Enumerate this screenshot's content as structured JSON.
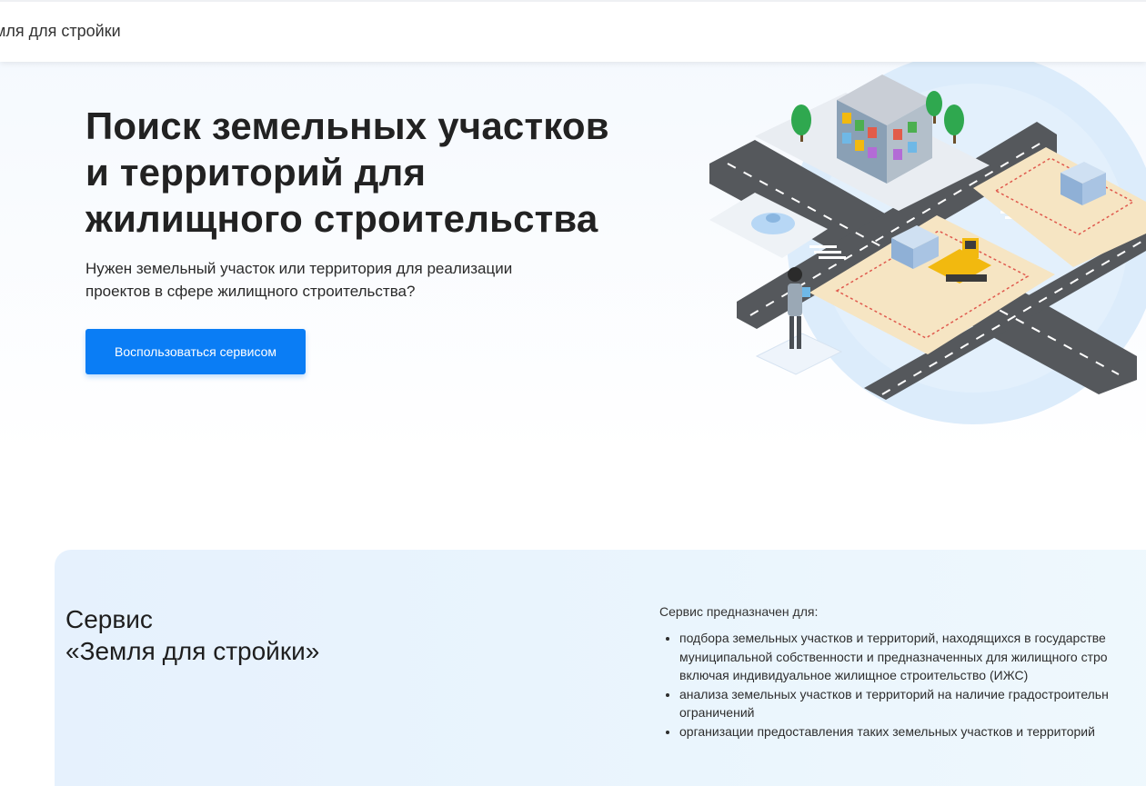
{
  "header": {
    "brand_text": "мля для стройки"
  },
  "hero": {
    "title_line1": "Поиск земельных участков",
    "title_line2": "и территорий для",
    "title_line3": "жилищного строительства",
    "subtitle_line1": "Нужен земельный участок или территория для реализации",
    "subtitle_line2": "проектов в сфере жилищного строительства?",
    "cta_label": "Воспользоваться сервисом"
  },
  "info": {
    "title_line1": "Сервис",
    "title_line2": "«Земля для стройки»",
    "purpose_intro": "Сервис предназначен для:",
    "purpose_items": [
      {
        "line1": "подбора земельных участков и территорий, находящихся в государстве",
        "line2": "муниципальной собственности и предназначенных для жилищного стро",
        "line3": "включая индивидуальное жилищное строительство (ИЖС)"
      },
      {
        "line1": "анализа земельных участков и территорий на наличие градостроительн",
        "line2": "ограничений"
      },
      {
        "line1": "организации предоставления таких земельных участков и территорий"
      }
    ]
  },
  "colors": {
    "accent": "#0a7df5",
    "road": "#55585c",
    "plot": "#f6e5c3",
    "plot_border": "#e05a4e",
    "bulldozer": "#f2b90f",
    "circle": "#dcecfb"
  }
}
